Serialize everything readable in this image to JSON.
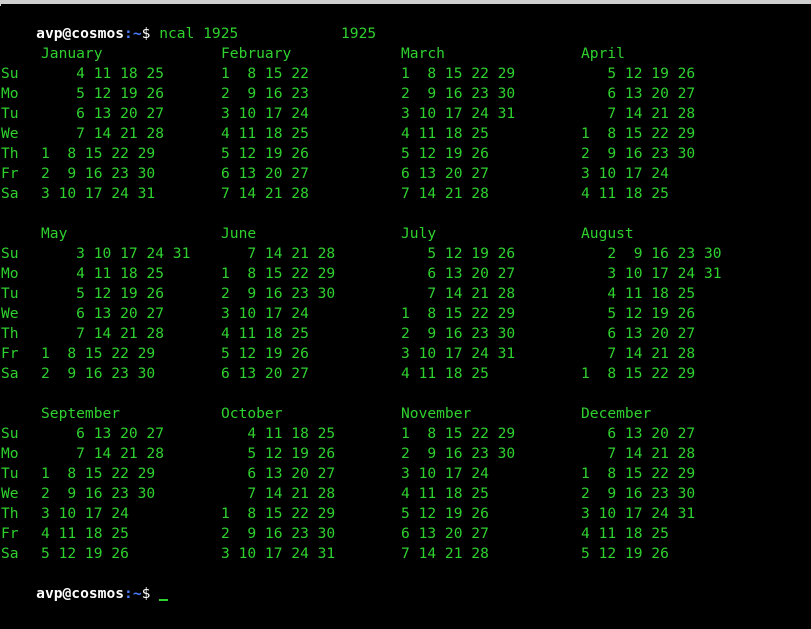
{
  "prompt": {
    "user_host": "avp@cosmos",
    "path": ":~",
    "sign": "$",
    "command": " ncal 1925"
  },
  "year": "1925",
  "weekdays": [
    "Su",
    "Mo",
    "Tu",
    "We",
    "Th",
    "Fr",
    "Sa"
  ],
  "rows": [
    {
      "months": [
        "January",
        "February",
        "March",
        "April"
      ],
      "lines": [
        [
          "    4 11 18 25",
          "1  8 15 22   ",
          "1  8 15 22 29",
          "   5 12 19 26"
        ],
        [
          "    5 12 19 26",
          "2  9 16 23   ",
          "2  9 16 23 30",
          "   6 13 20 27"
        ],
        [
          "    6 13 20 27",
          "3 10 17 24   ",
          "3 10 17 24 31",
          "   7 14 21 28"
        ],
        [
          "    7 14 21 28",
          "4 11 18 25   ",
          "4 11 18 25   ",
          "1  8 15 22 29"
        ],
        [
          "1  8 15 22 29",
          "5 12 19 26   ",
          "5 12 19 26   ",
          "2  9 16 23 30"
        ],
        [
          "2  9 16 23 30",
          "6 13 20 27   ",
          "6 13 20 27   ",
          "3 10 17 24   "
        ],
        [
          "3 10 17 24 31",
          "7 14 21 28   ",
          "7 14 21 28   ",
          "4 11 18 25   "
        ]
      ]
    },
    {
      "months": [
        "May",
        "June",
        "July",
        "August"
      ],
      "lines": [
        [
          "    3 10 17 24 31",
          "   7 14 21 28",
          "   5 12 19 26",
          "   2  9 16 23 30"
        ],
        [
          "    4 11 18 25",
          "1  8 15 22 29",
          "   6 13 20 27",
          "   3 10 17 24 31"
        ],
        [
          "    5 12 19 26",
          "2  9 16 23 30",
          "   7 14 21 28",
          "   4 11 18 25"
        ],
        [
          "    6 13 20 27",
          "3 10 17 24",
          "1  8 15 22 29",
          "   5 12 19 26"
        ],
        [
          "    7 14 21 28",
          "4 11 18 25",
          "2  9 16 23 30",
          "   6 13 20 27"
        ],
        [
          "1  8 15 22 29",
          "5 12 19 26",
          "3 10 17 24 31",
          "   7 14 21 28"
        ],
        [
          "2  9 16 23 30",
          "6 13 20 27",
          "4 11 18 25",
          "1  8 15 22 29"
        ]
      ]
    },
    {
      "months": [
        "September",
        "October",
        "November",
        "December"
      ],
      "lines": [
        [
          "    6 13 20 27",
          "   4 11 18 25",
          "1  8 15 22 29",
          "   6 13 20 27"
        ],
        [
          "    7 14 21 28",
          "   5 12 19 26",
          "2  9 16 23 30",
          "   7 14 21 28"
        ],
        [
          "1  8 15 22 29",
          "   6 13 20 27",
          "3 10 17 24",
          "1  8 15 22 29"
        ],
        [
          "2  9 16 23 30",
          "   7 14 21 28",
          "4 11 18 25",
          "2  9 16 23 30"
        ],
        [
          "3 10 17 24",
          "1  8 15 22 29",
          "5 12 19 26",
          "3 10 17 24 31"
        ],
        [
          "4 11 18 25",
          "2  9 16 23 30",
          "6 13 20 27",
          "4 11 18 25"
        ],
        [
          "5 12 19 26",
          "3 10 17 24 31",
          "7 14 21 28",
          "5 12 19 26"
        ]
      ]
    }
  ],
  "colors": {
    "background": "#000000",
    "text": "#2fd12f",
    "prompt_user": "#ffffff",
    "prompt_path": "#4a7bff"
  }
}
